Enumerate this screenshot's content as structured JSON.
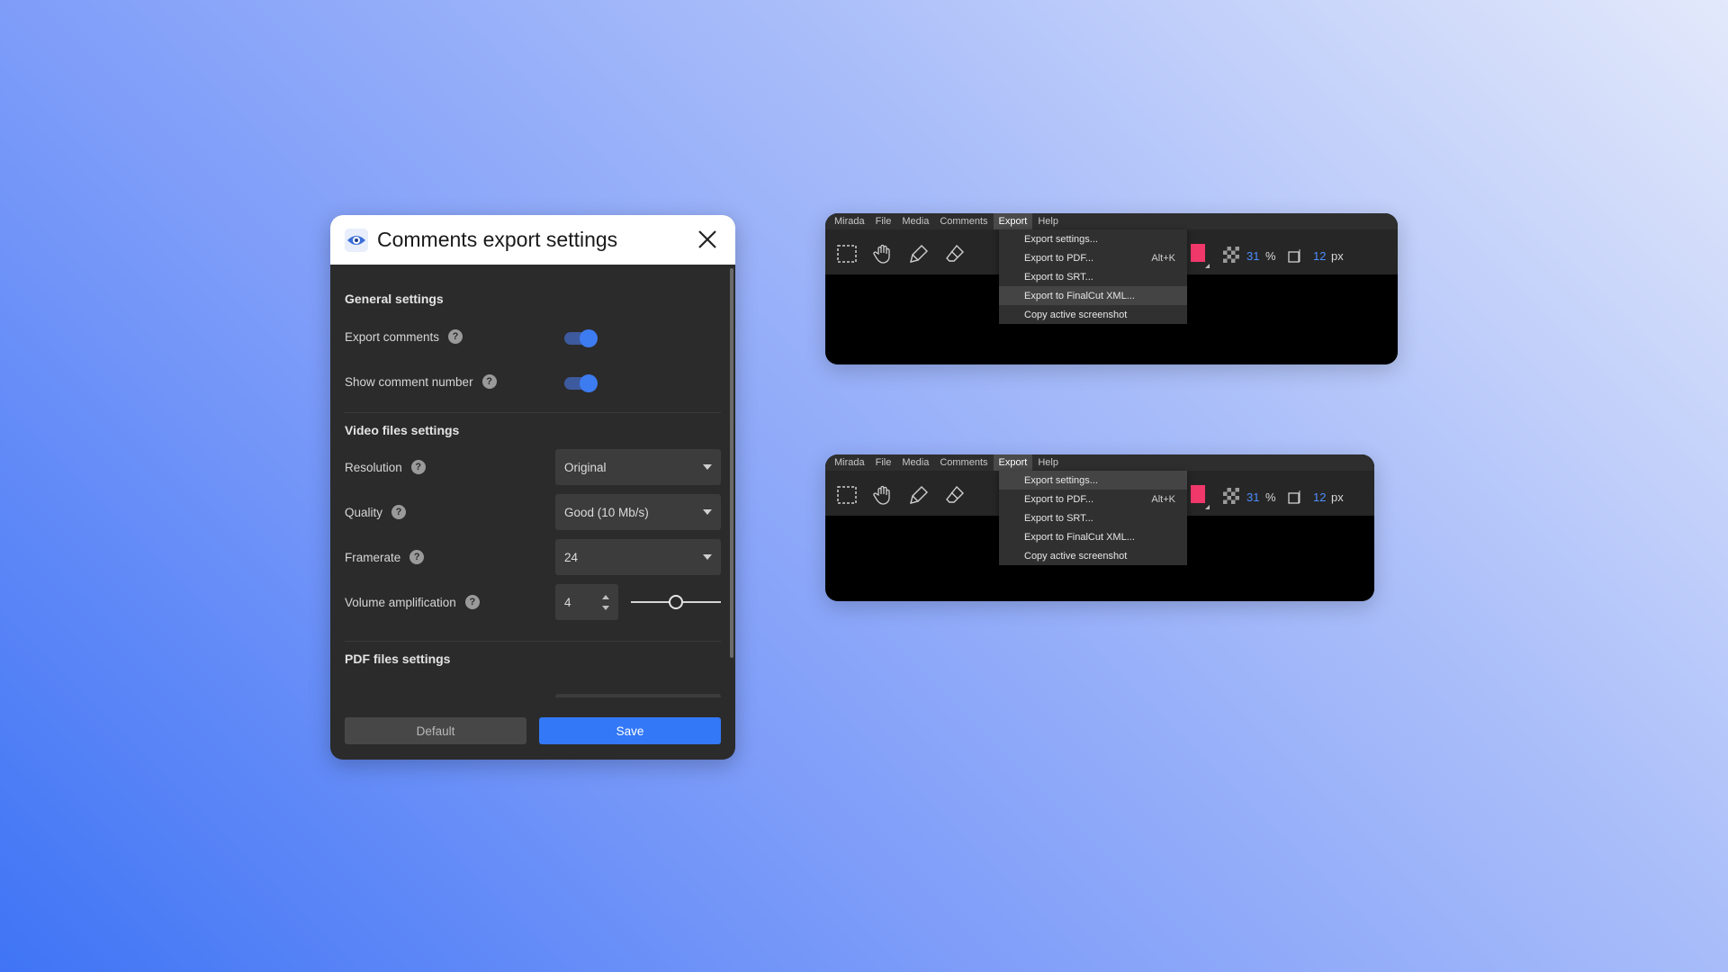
{
  "dialog": {
    "title": "Comments export settings",
    "sections": {
      "general": "General settings",
      "video": "Video files settings",
      "pdf": "PDF files settings"
    },
    "rows": {
      "export_comments": "Export comments",
      "show_comment_number": "Show comment number",
      "resolution": "Resolution",
      "quality": "Quality",
      "framerate": "Framerate",
      "volume_amplification": "Volume amplification"
    },
    "help_glyph": "?",
    "toggles": {
      "export_comments": true,
      "show_comment_number": true
    },
    "values": {
      "resolution": "Original",
      "quality": "Good (10 Mb/s)",
      "framerate": "24",
      "volume_amplification": "4",
      "volume_slider_fraction": 0.5
    },
    "buttons": {
      "default": "Default",
      "save": "Save"
    }
  },
  "app_window_1": {
    "menus": [
      "Mirada",
      "File",
      "Media",
      "Comments",
      "Export",
      "Help"
    ],
    "active_menu": "Export",
    "dropdown": [
      {
        "label": "Export settings...",
        "shortcut": ""
      },
      {
        "label": "Export to PDF...",
        "shortcut": "Alt+K"
      },
      {
        "label": "Export to SRT...",
        "shortcut": ""
      },
      {
        "label": "Export to FinalCut XML...",
        "shortcut": ""
      },
      {
        "label": "Copy active screenshot",
        "shortcut": ""
      }
    ],
    "highlighted_item": "Export to FinalCut XML...",
    "opacity_value": "31",
    "opacity_unit": "%",
    "size_value": "12",
    "size_unit": "px"
  },
  "app_window_2": {
    "menus": [
      "Mirada",
      "File",
      "Media",
      "Comments",
      "Export",
      "Help"
    ],
    "active_menu": "Export",
    "dropdown": [
      {
        "label": "Export settings...",
        "shortcut": ""
      },
      {
        "label": "Export to PDF...",
        "shortcut": "Alt+K"
      },
      {
        "label": "Export to SRT...",
        "shortcut": ""
      },
      {
        "label": "Export to FinalCut XML...",
        "shortcut": ""
      },
      {
        "label": "Copy active screenshot",
        "shortcut": ""
      }
    ],
    "highlighted_item": "Export settings...",
    "opacity_value": "31",
    "opacity_unit": "%",
    "size_value": "12",
    "size_unit": "px"
  },
  "colors": {
    "accent": "#3378f6",
    "toggle_knob": "#3d7bf0",
    "swatch": "#f0386b",
    "value_blue": "#4d8dff"
  },
  "icons": {
    "dialog": [
      "app-logo-icon",
      "close-icon",
      "help-icon",
      "caret-down-icon"
    ],
    "toolbar": [
      "marquee-select-icon",
      "hand-icon",
      "highlighter-icon",
      "eraser-icon",
      "opacity-grid-icon",
      "brush-size-icon"
    ]
  }
}
